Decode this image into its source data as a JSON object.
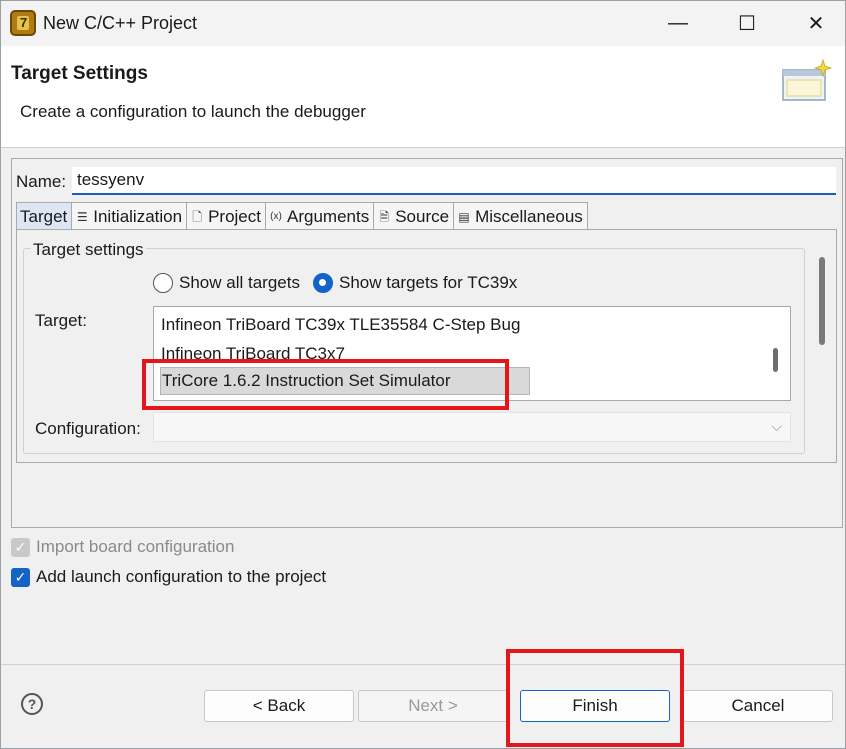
{
  "window": {
    "title": "New C/C++ Project",
    "icon_text": "7",
    "controls": {
      "minimize": "—",
      "maximize": "☐",
      "close": "✕"
    }
  },
  "banner": {
    "title": "Target Settings",
    "description": "Create a configuration to launch the debugger"
  },
  "name": {
    "label": "Name:",
    "value": "tessyenv"
  },
  "tabs": [
    {
      "label": "Target",
      "icon": "",
      "active": true
    },
    {
      "label": "Initialization",
      "icon": "list-icon"
    },
    {
      "label": "Project",
      "icon": "document-icon"
    },
    {
      "label": "Arguments",
      "icon": "variable-icon"
    },
    {
      "label": "Source",
      "icon": "source-icon"
    },
    {
      "label": "Miscellaneous",
      "icon": "table-icon"
    }
  ],
  "target_settings": {
    "group_title": "Target settings",
    "radio_all": "Show all targets",
    "radio_filtered": "Show targets for TC39x",
    "selected_radio": "filtered",
    "target_label": "Target:",
    "targets": [
      "Infineon TriBoard TC39x TLE35584 C-Step Bug",
      "Infineon TriBoard TC3x7",
      "TriCore 1.6.2 Instruction Set Simulator"
    ],
    "selected_target": "TriCore 1.6.2 Instruction Set Simulator",
    "configuration_label": "Configuration:",
    "configuration_value": ""
  },
  "options": {
    "import_board": "Import board configuration",
    "add_launch": "Add launch configuration to the project"
  },
  "buttons": {
    "help": "?",
    "back": "< Back",
    "next": "Next >",
    "finish": "Finish",
    "cancel": "Cancel"
  },
  "colors": {
    "accent": "#1464c8",
    "annotation": "#e2161b"
  }
}
